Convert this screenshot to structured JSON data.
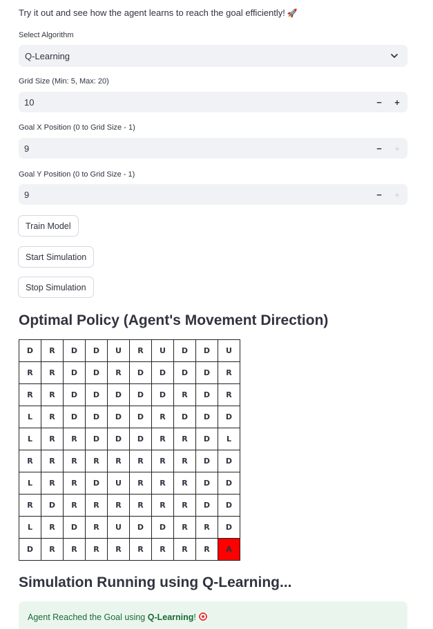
{
  "intro_text": "Try it out and see how the agent learns to reach the goal efficiently!",
  "algorithm": {
    "label": "Select Algorithm",
    "value": "Q-Learning"
  },
  "grid_size": {
    "label": "Grid Size (Min: 5, Max: 20)",
    "value": "10"
  },
  "goal_x": {
    "label": "Goal X Position (0 to Grid Size - 1)",
    "value": "9"
  },
  "goal_y": {
    "label": "Goal Y Position (0 to Grid Size - 1)",
    "value": "9"
  },
  "buttons": {
    "train": "Train Model",
    "start": "Start Simulation",
    "stop": "Stop Simulation"
  },
  "policy_heading": "Optimal Policy (Agent's Movement Direction)",
  "policy_grid": [
    [
      "D",
      "R",
      "D",
      "D",
      "U",
      "R",
      "U",
      "D",
      "D",
      "U"
    ],
    [
      "R",
      "R",
      "D",
      "D",
      "R",
      "D",
      "D",
      "D",
      "D",
      "R"
    ],
    [
      "R",
      "R",
      "D",
      "D",
      "D",
      "D",
      "D",
      "R",
      "D",
      "R"
    ],
    [
      "L",
      "R",
      "D",
      "D",
      "D",
      "D",
      "R",
      "D",
      "D",
      "D"
    ],
    [
      "L",
      "R",
      "R",
      "D",
      "D",
      "D",
      "R",
      "R",
      "D",
      "L"
    ],
    [
      "R",
      "R",
      "R",
      "R",
      "R",
      "R",
      "R",
      "R",
      "D",
      "D"
    ],
    [
      "L",
      "R",
      "R",
      "D",
      "U",
      "R",
      "R",
      "R",
      "D",
      "D"
    ],
    [
      "R",
      "D",
      "R",
      "R",
      "R",
      "R",
      "R",
      "R",
      "D",
      "D"
    ],
    [
      "L",
      "R",
      "D",
      "R",
      "U",
      "D",
      "D",
      "R",
      "R",
      "D"
    ],
    [
      "D",
      "R",
      "R",
      "R",
      "R",
      "R",
      "R",
      "R",
      "R",
      "A"
    ]
  ],
  "goal_color": "#ff0000",
  "sim_heading": "Simulation Running using Q-Learning...",
  "success": {
    "prefix": "Agent Reached the Goal using ",
    "algo": "Q-Learning",
    "suffix": "!"
  }
}
